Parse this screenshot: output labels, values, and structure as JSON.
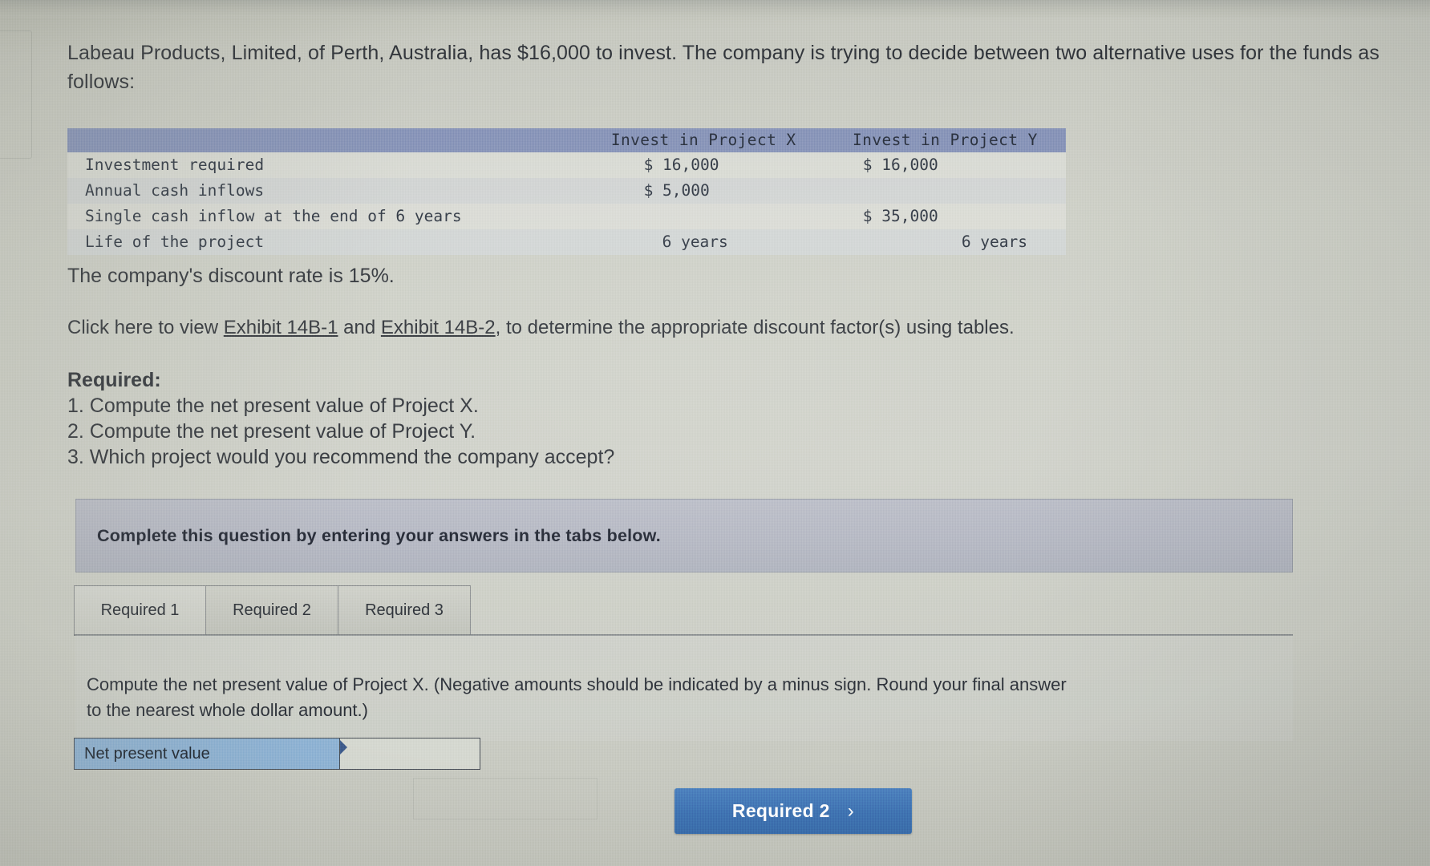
{
  "intro": {
    "paragraph": "Labeau Products, Limited, of Perth, Australia, has $16,000 to invest. The company is trying to decide between two alternative uses for the funds as follows:"
  },
  "table": {
    "columns": [
      "",
      "Invest in Project X",
      "Invest in Project Y"
    ],
    "rows": [
      {
        "label": "Investment required",
        "x": "$ 16,000",
        "y": "$ 16,000"
      },
      {
        "label": "Annual cash inflows",
        "x": "$ 5,000",
        "y": ""
      },
      {
        "label": "Single cash inflow at the end of 6 years",
        "x": "",
        "y": "$ 35,000"
      },
      {
        "label": "Life of the project",
        "x": "6 years",
        "y": "6 years"
      }
    ]
  },
  "discount_rate_text": "The company's discount rate is 15%.",
  "exhibit": {
    "prefix": "Click here to view ",
    "link1": "Exhibit 14B-1",
    "middle": " and ",
    "link2": "Exhibit 14B-2",
    "suffix": ", to determine the appropriate discount factor(s) using tables."
  },
  "required": {
    "heading": "Required:",
    "items": [
      "1. Compute the net present value of Project X.",
      "2. Compute the net present value of Project Y.",
      "3. Which project would you recommend the company accept?"
    ]
  },
  "banner": {
    "text": "Complete this question by entering your answers in the tabs below."
  },
  "tabs": [
    {
      "label": "Required 1",
      "active": true
    },
    {
      "label": "Required 2",
      "active": false
    },
    {
      "label": "Required 3",
      "active": false
    }
  ],
  "panel": {
    "instruction_line1": "Compute the net present value of Project X. (Negative amounts should be indicated by a minus sign. Round your final answer",
    "instruction_line2": "to the nearest whole dollar amount.)"
  },
  "answer": {
    "label": "Net present value",
    "value": "",
    "placeholder": ""
  },
  "footer": {
    "next_button_label": "Required 2",
    "next_button_chevron": "chevron-right-icon",
    "next_button_chevron_glyph": "›"
  },
  "colors": {
    "page_background": "#cdcfc6",
    "table_header": "#8491b6",
    "banner": "#b4b7c2",
    "answer_label": "#8fb3d4",
    "primary_button": "#3f73b3",
    "text": "#2d3137"
  }
}
